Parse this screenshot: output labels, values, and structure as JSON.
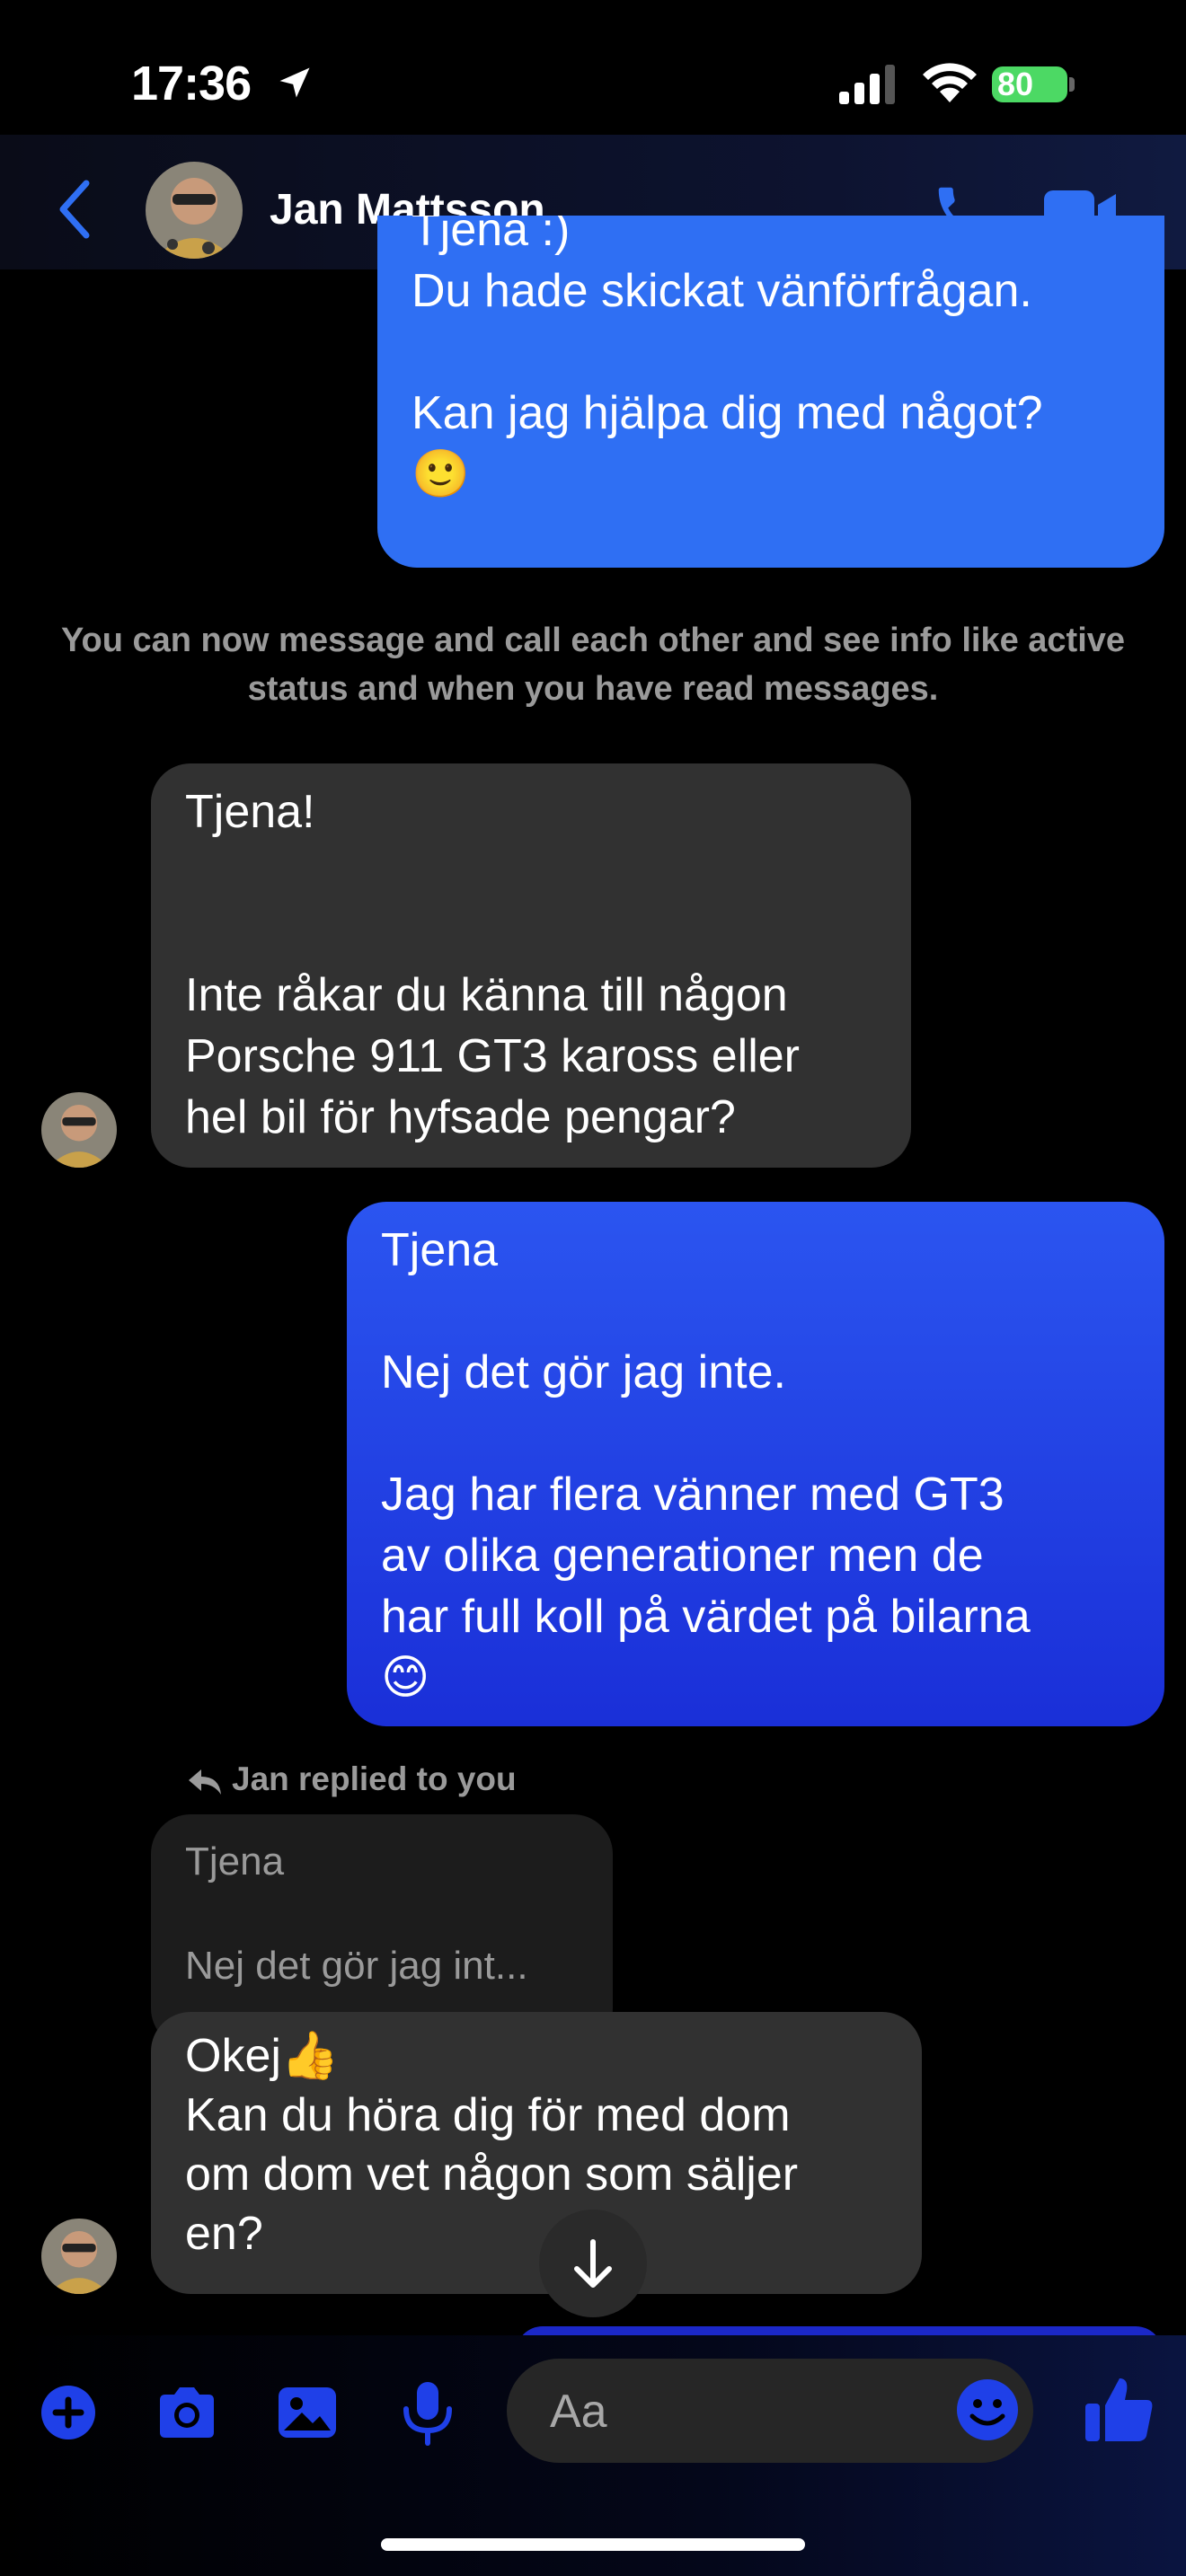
{
  "status_bar": {
    "time": "17:36",
    "battery": "80"
  },
  "header": {
    "contact_name": "Jan Mattsson"
  },
  "messages": [
    {
      "direction": "outgoing",
      "text": "Tjena :)\nDu hade skickat vänförfrågan.\n\nKan jag hjälpa dig med något?\n🙂"
    },
    {
      "direction": "incoming",
      "text": "Tjena!\n\n\nInte råkar du känna till någon\nPorsche 911 GT3 kaross eller\nhel bil för hyfsade pengar?"
    },
    {
      "direction": "outgoing",
      "text": "Tjena\n\nNej det gör jag inte.\n\nJag har flera vänner med GT3\nav olika generationer men de\nhar full koll på värdet på bilarna\n😊"
    },
    {
      "direction": "incoming",
      "text": "Okej👍\nKan du höra dig för med dom\nom dom vet någon som säljer\nen?"
    }
  ],
  "system_message": "You can now message and call each other and see info like active status and when you have read messages.",
  "reply": {
    "label": "Jan replied to you",
    "quoted_text": "Tjena\n\nNej det gör jag int..."
  },
  "composer": {
    "placeholder": "Aa"
  },
  "colors": {
    "accent": "#2f6ff3",
    "outgoing_bubble": "#2f6ff3",
    "incoming_bubble": "#313131",
    "battery_green": "#4cd964"
  },
  "icons": [
    "location-arrow-icon",
    "signal-icon",
    "wifi-icon",
    "battery-icon",
    "back-chevron-icon",
    "phone-icon",
    "video-camera-icon",
    "reply-arrow-icon",
    "arrow-down-icon",
    "plus-icon",
    "camera-icon",
    "image-icon",
    "microphone-icon",
    "emoji-icon",
    "thumbs-up-icon"
  ]
}
